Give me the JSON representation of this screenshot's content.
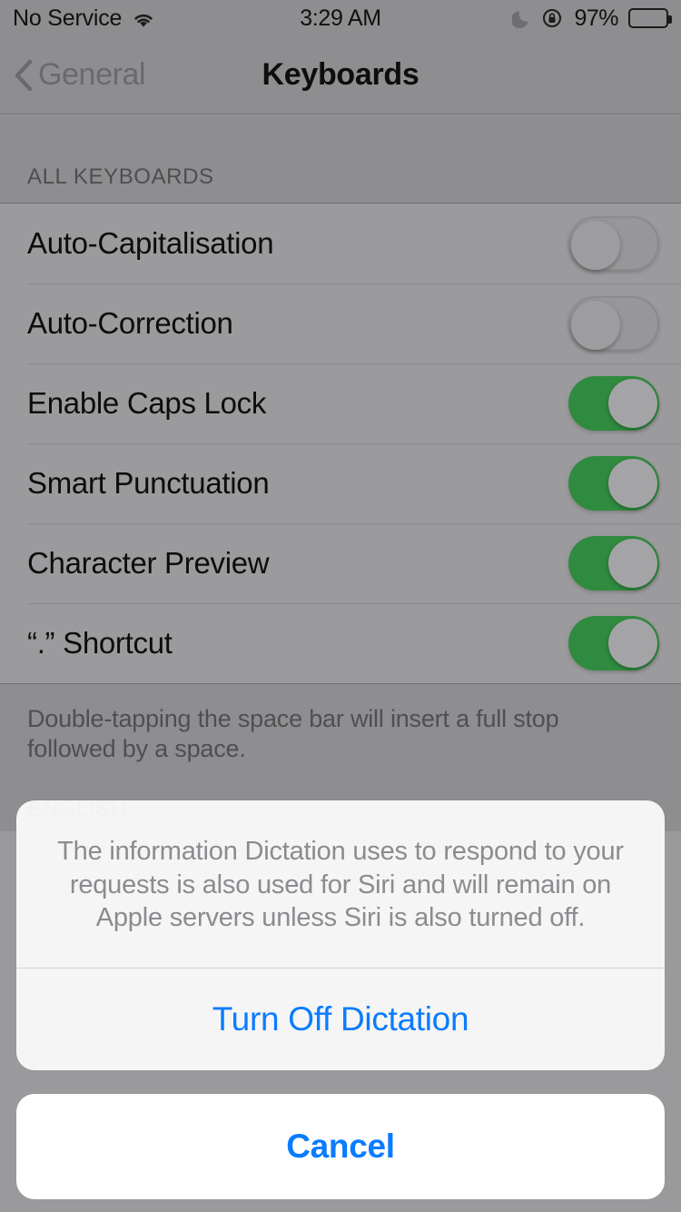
{
  "status_bar": {
    "carrier": "No Service",
    "wifi_icon": "wifi-icon",
    "time": "3:29 AM",
    "dnd_icon": "moon-icon",
    "rotation_lock_icon": "rotation-lock-icon",
    "battery_percent": "97%",
    "battery_level": 97
  },
  "nav_bar": {
    "back_label": "General",
    "back_icon": "chevron-left-icon",
    "title": "Keyboards"
  },
  "sections": [
    {
      "header": "ALL KEYBOARDS",
      "rows": [
        {
          "label": "Auto-Capitalisation",
          "toggle": "off"
        },
        {
          "label": "Auto-Correction",
          "toggle": "off"
        },
        {
          "label": "Enable Caps Lock",
          "toggle": "on"
        },
        {
          "label": "Smart Punctuation",
          "toggle": "on"
        },
        {
          "label": "Character Preview",
          "toggle": "on"
        },
        {
          "label": "“.” Shortcut",
          "toggle": "on"
        }
      ],
      "footer": "Double-tapping the space bar will insert a full stop followed by a space."
    },
    {
      "header": "ENGLISH",
      "rows": [],
      "footer": ""
    }
  ],
  "action_sheet": {
    "message": "The information Dictation uses to respond to your requests is also used for Siri and will remain on Apple servers unless Siri is also turned off.",
    "destructive_label": "Turn Off Dictation",
    "cancel_label": "Cancel"
  },
  "colors": {
    "accent_blue": "#0a7cff",
    "toggle_on_green": "#2f8b3f",
    "background_gray": "#9a9a9c",
    "header_gray": "#8e8e90"
  }
}
